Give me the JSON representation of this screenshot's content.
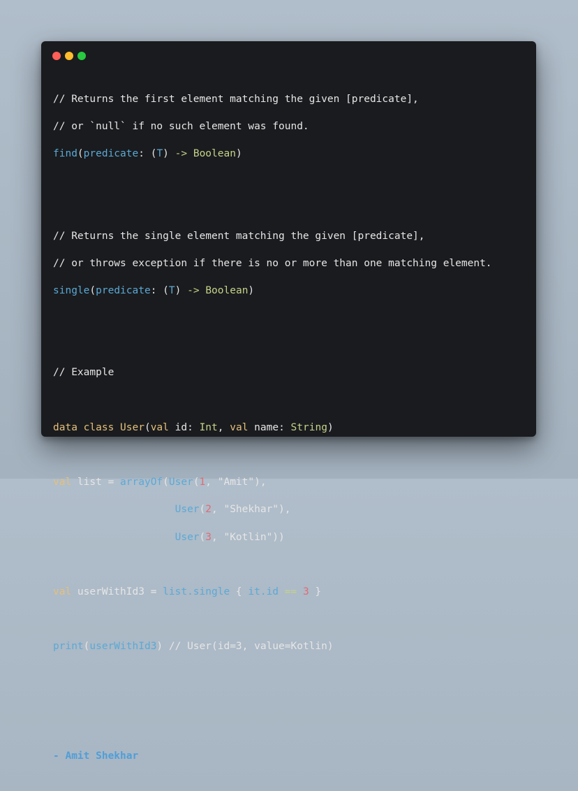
{
  "window": {
    "dots": [
      {
        "name": "close",
        "color": "#ff5f57"
      },
      {
        "name": "minimize",
        "color": "#febc2e"
      },
      {
        "name": "zoom",
        "color": "#28c840"
      }
    ]
  },
  "code": {
    "find_comment_1": "// Returns the first element matching the given [predicate],",
    "find_comment_2": "// or `null` if no such element was found.",
    "find_fn": "find",
    "find_open": "(",
    "find_param": "predicate",
    "find_colon": ": (",
    "find_t": "T",
    "find_close_t": ") ",
    "find_arrow": "->",
    "find_space": " ",
    "find_bool": "Boolean",
    "find_end": ")",
    "single_comment_1": "// Returns the single element matching the given [predicate],",
    "single_comment_2": "// or throws exception if there is no or more than one matching element.",
    "single_fn": "single",
    "single_open": "(",
    "single_param": "predicate",
    "single_colon": ": (",
    "single_t": "T",
    "single_close_t": ") ",
    "single_arrow": "->",
    "single_space": " ",
    "single_bool": "Boolean",
    "single_end": ")",
    "example_comment": "// Example",
    "dc_kw": "data class",
    "dc_space": " ",
    "dc_name": "User",
    "dc_open": "(",
    "dc_val1": "val",
    "dc_id": " id: ",
    "dc_int": "Int",
    "dc_comma": ", ",
    "dc_val2": "val",
    "dc_namefield": " name: ",
    "dc_string": "String",
    "dc_end": ")",
    "list_val": "val",
    "list_mid": " list = ",
    "list_fn": "arrayOf",
    "list_open": "(",
    "user1_fn": "User",
    "user1_open": "(",
    "user1_num": "1",
    "user1_rest": ", \"Amit\"),",
    "indent": "                    ",
    "user2_fn": "User",
    "user2_open": "(",
    "user2_num": "2",
    "user2_rest": ", \"Shekhar\"),",
    "user3_fn": "User",
    "user3_open": "(",
    "user3_num": "3",
    "user3_rest": ", \"Kotlin\"))",
    "uw_val": "val",
    "uw_mid": " userWithId3 = ",
    "uw_list": "list.single",
    "uw_brace": " { ",
    "uw_it": "it.id",
    "uw_eq": " == ",
    "uw_num": "3",
    "uw_end": " }",
    "print_fn": "print",
    "print_open": "(",
    "print_arg": "userWithId3",
    "print_close": ") ",
    "print_comment": "// User(id=3, value=Kotlin)",
    "author": "- Amit Shekhar"
  }
}
